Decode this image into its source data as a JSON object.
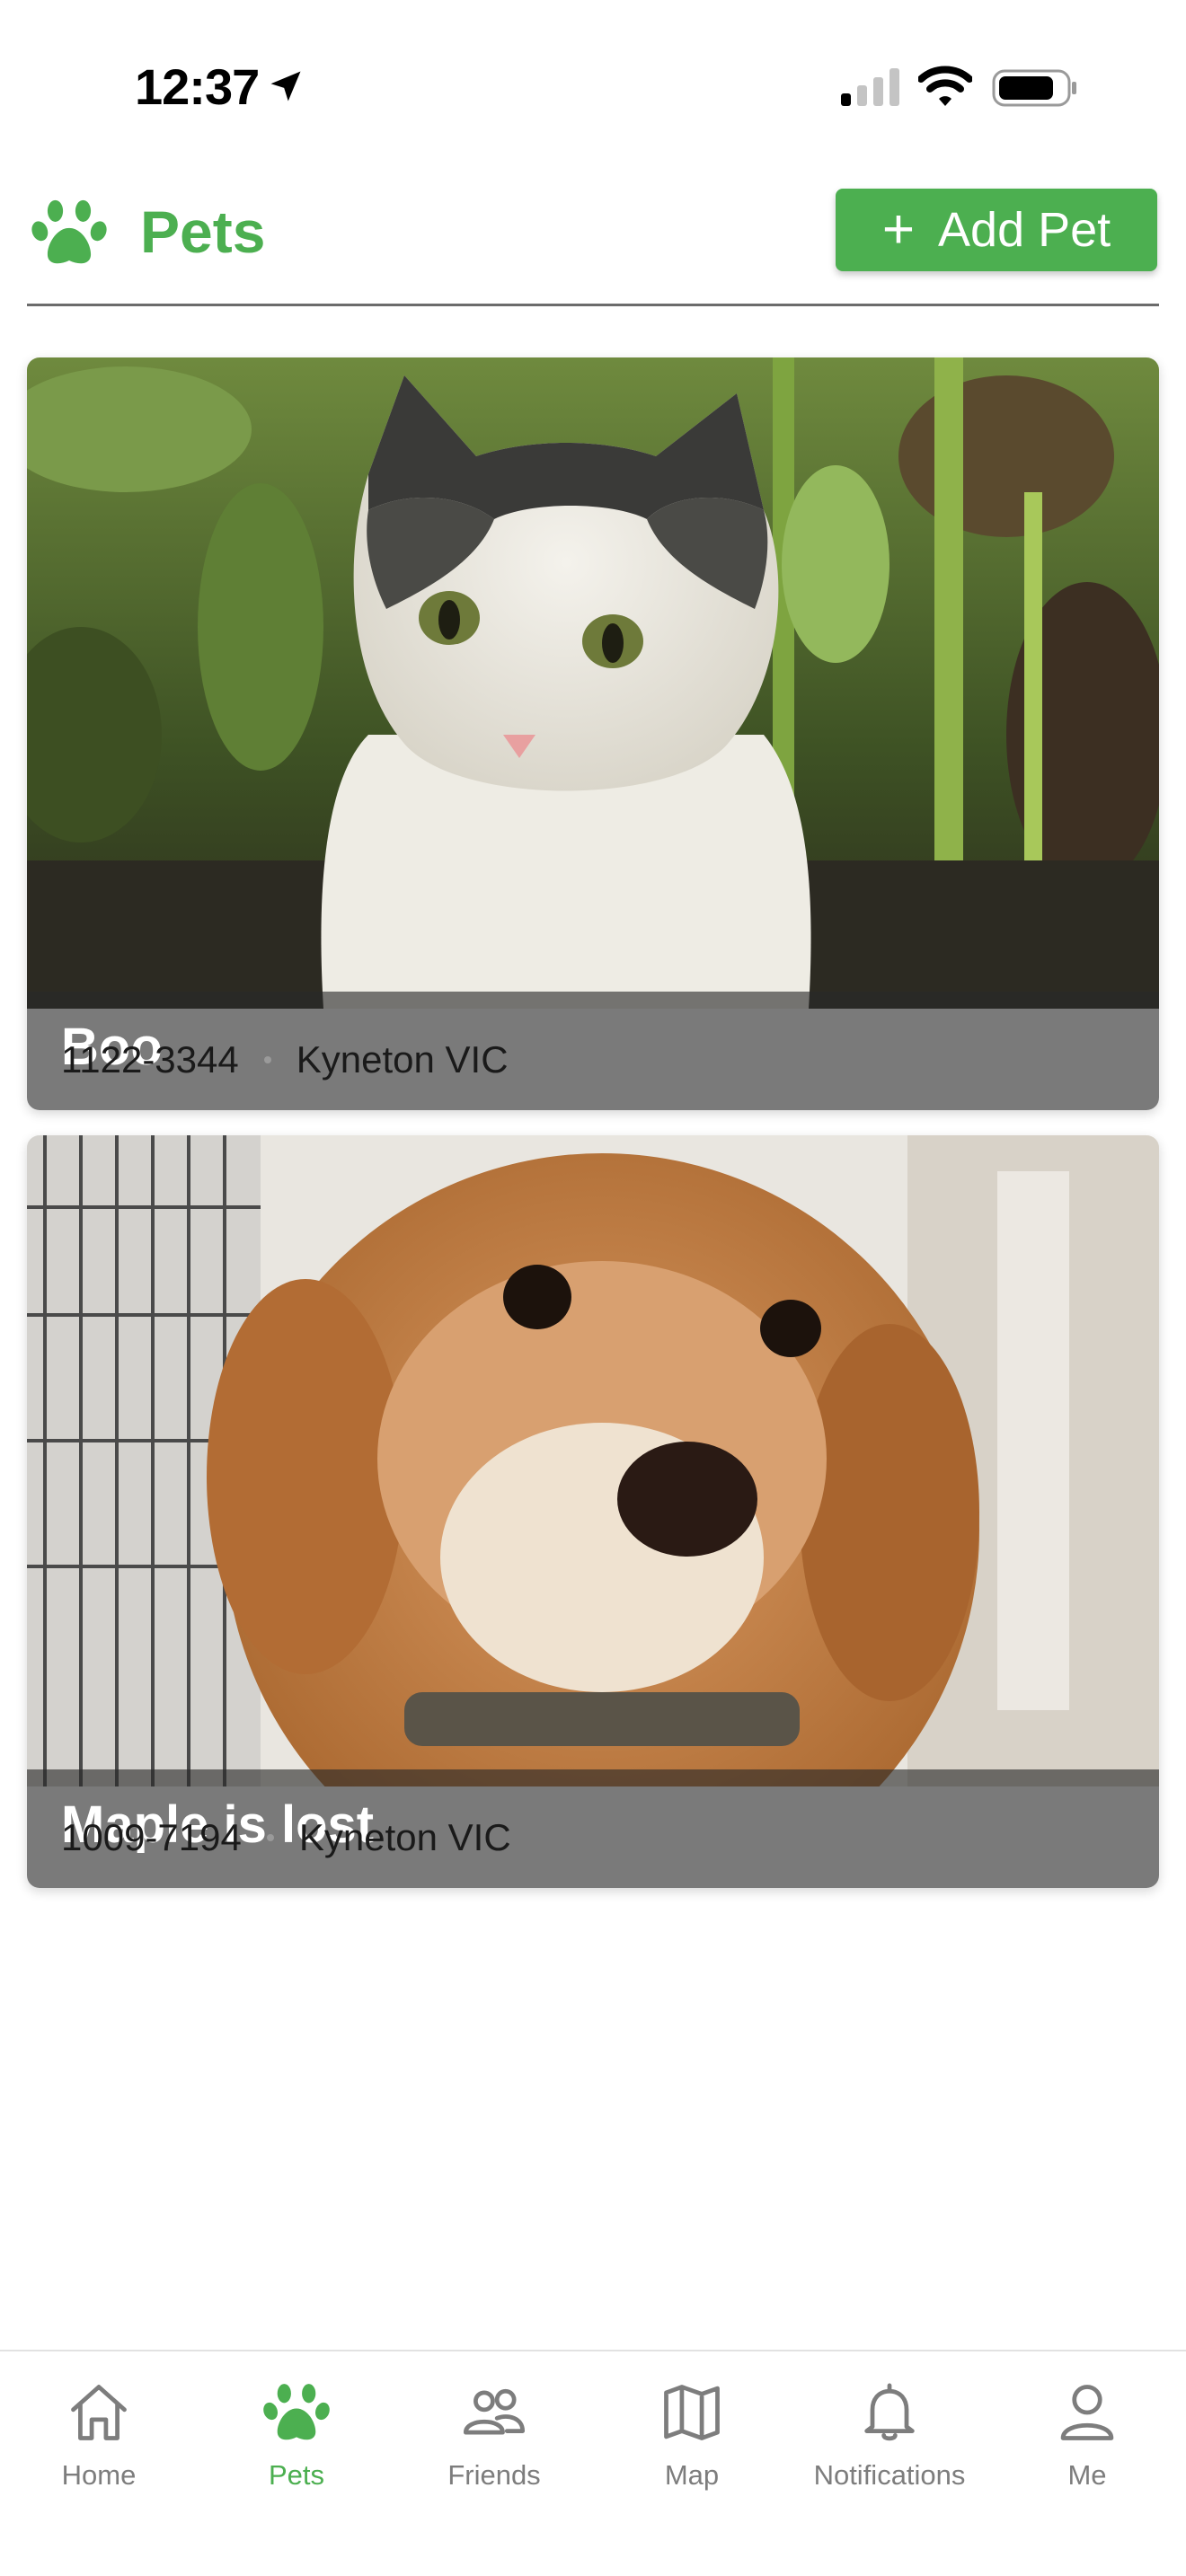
{
  "status_bar": {
    "time": "12:37"
  },
  "header": {
    "title": "Pets",
    "add_pet_label": "Add Pet",
    "add_pet_icon": "plus-icon"
  },
  "pets": [
    {
      "name": "Boo",
      "id_number": "1122-3344",
      "location": "Kyneton VIC"
    },
    {
      "name": "Maple is lost",
      "id_number": "1009-7194",
      "location": "Kyneton VIC"
    }
  ],
  "tab_bar": {
    "tabs": [
      {
        "label": "Home",
        "icon": "home-icon"
      },
      {
        "label": "Pets",
        "icon": "paw-icon",
        "active": true
      },
      {
        "label": "Friends",
        "icon": "friends-icon"
      },
      {
        "label": "Map",
        "icon": "map-icon"
      },
      {
        "label": "Notifications",
        "icon": "bell-icon"
      },
      {
        "label": "Me",
        "icon": "person-icon"
      }
    ]
  },
  "colors": {
    "accent": "#4caf50",
    "inactive_tab": "#7d7d7d",
    "divider": "#6b6b6b"
  }
}
